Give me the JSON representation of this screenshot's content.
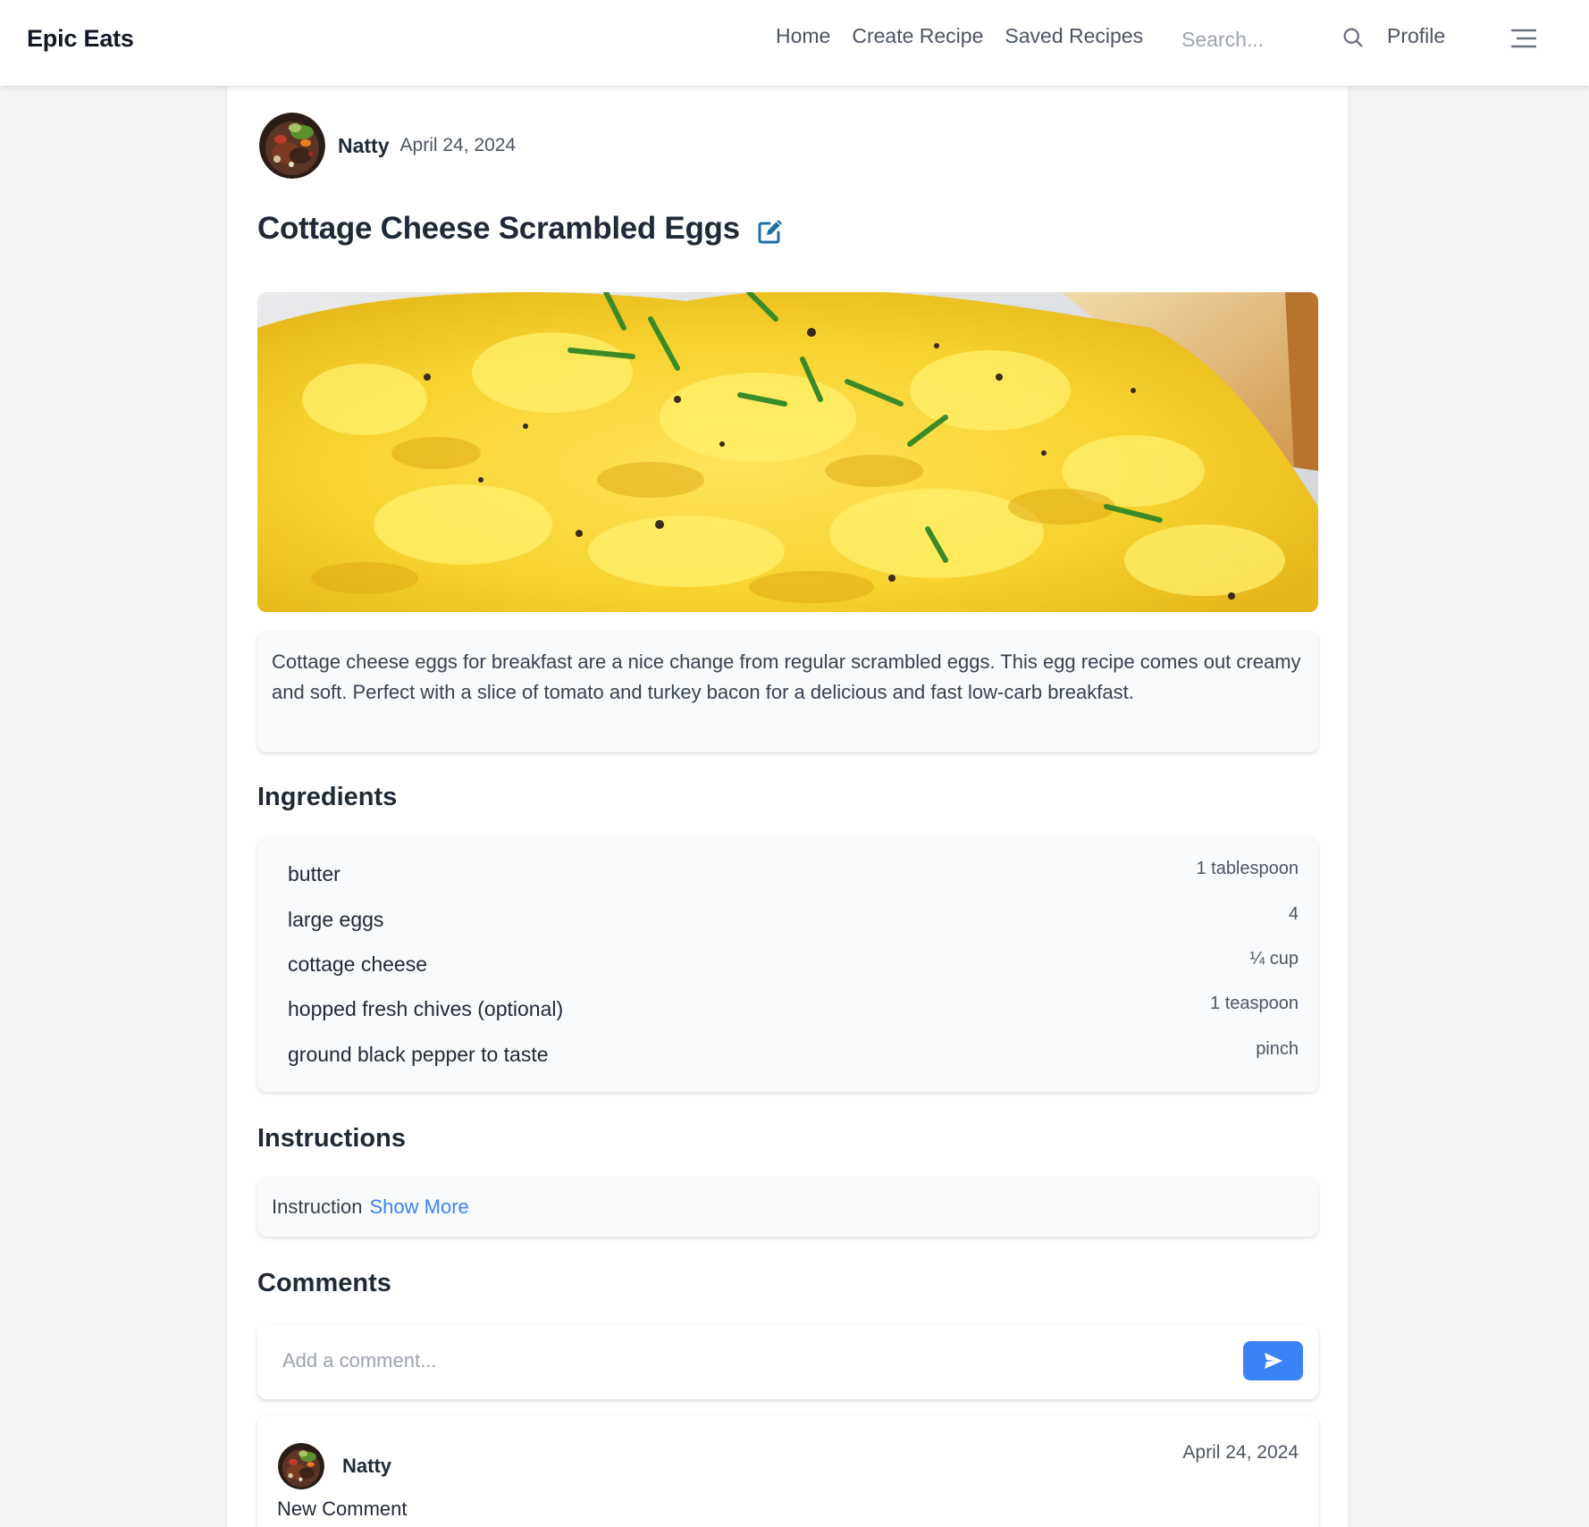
{
  "header": {
    "brand": "Epic Eats",
    "nav": [
      "Home",
      "Create Recipe",
      "Saved Recipes"
    ],
    "search_placeholder": "Search...",
    "profile": "Profile",
    "icons": {
      "search": "search-icon",
      "menu": "hamburger-menu-icon"
    }
  },
  "post": {
    "author": "Natty",
    "date": "April 24, 2024",
    "title": "Cottage Cheese Scrambled Eggs",
    "description": "Cottage cheese eggs for breakfast are a nice change from regular scrambled eggs. This egg recipe comes out creamy and soft. Perfect with a slice of tomato and turkey bacon for a delicious and fast low-carb breakfast."
  },
  "ingredients": {
    "heading": "Ingredients",
    "items": [
      {
        "name": "butter",
        "qty": "1 tablespoon"
      },
      {
        "name": "large eggs",
        "qty": "4"
      },
      {
        "name": "cottage cheese",
        "qty": "¼ cup"
      },
      {
        "name": "hopped fresh chives (optional)",
        "qty": "1 teaspoon"
      },
      {
        "name": "ground black pepper to taste",
        "qty": "pinch"
      }
    ]
  },
  "instructions": {
    "heading": "Instructions",
    "text": "Instruction",
    "show_more": "Show More"
  },
  "comments": {
    "heading": "Comments",
    "placeholder": "Add a comment...",
    "items": [
      {
        "author": "Natty",
        "date": "April 24, 2024",
        "text": "New Comment"
      }
    ]
  },
  "colors": {
    "accent": "#3b82f6",
    "edit_icon": "#1d6fa5",
    "page_bg": "#f3f4f6",
    "card_bg": "#f9fafb"
  }
}
